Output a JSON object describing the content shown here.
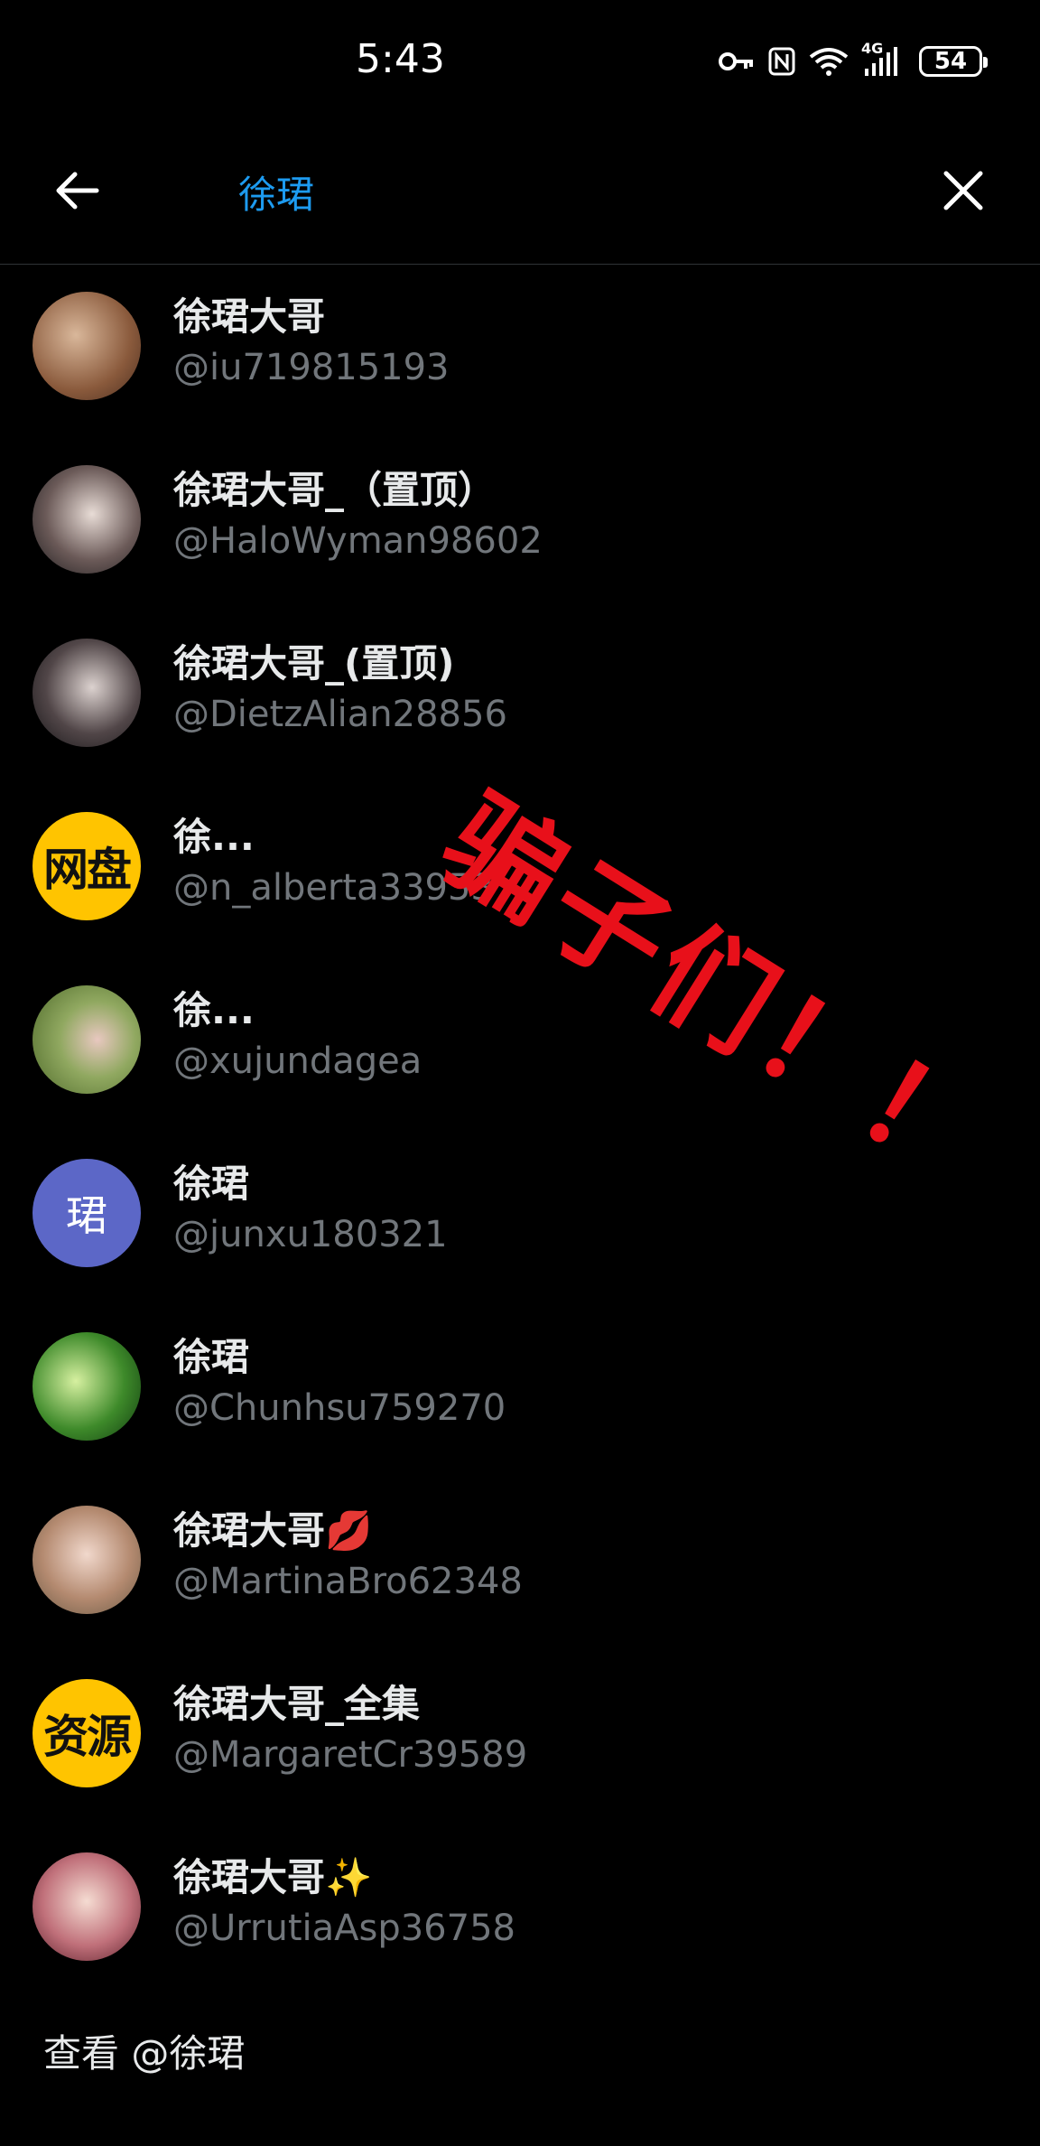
{
  "status_bar": {
    "time": "5:43",
    "network_label": "4G",
    "battery": "54",
    "icons": [
      "key-icon",
      "nfc-icon",
      "wifi-icon",
      "signal-icon",
      "battery-icon"
    ]
  },
  "search": {
    "query": "徐珺",
    "accent_color": "#1d9bf0"
  },
  "results": [
    {
      "name": "徐珺大哥",
      "handle": "@iu719815193",
      "avatar": "photo"
    },
    {
      "name": "徐珺大哥_（置顶）",
      "handle": "@HaloWyman98602",
      "avatar": "photo"
    },
    {
      "name": "徐珺大哥_(置顶)",
      "handle": "@DietzAlian28856",
      "avatar": "photo"
    },
    {
      "name": "徐...",
      "handle": "@n_alberta33953",
      "avatar_text": "网盘"
    },
    {
      "name": "徐...",
      "handle": "@xujundagea",
      "avatar": "photo"
    },
    {
      "name": "徐珺",
      "handle": "@junxu180321",
      "avatar_text": "珺"
    },
    {
      "name": "徐珺",
      "handle": "@Chunhsu759270",
      "avatar": "photo"
    },
    {
      "name": "徐珺大哥💋",
      "handle": "@MartinaBro62348",
      "avatar": "photo"
    },
    {
      "name": "徐珺大哥_全集",
      "handle": "@MargaretCr39589",
      "avatar_text": "资源"
    },
    {
      "name": "徐珺大哥✨",
      "handle": "@UrrutiaAsp36758",
      "avatar": "photo"
    }
  ],
  "go_to_user": "查看 @徐珺",
  "overlay": "骗子们！！",
  "overlay_color": "#e8101a"
}
